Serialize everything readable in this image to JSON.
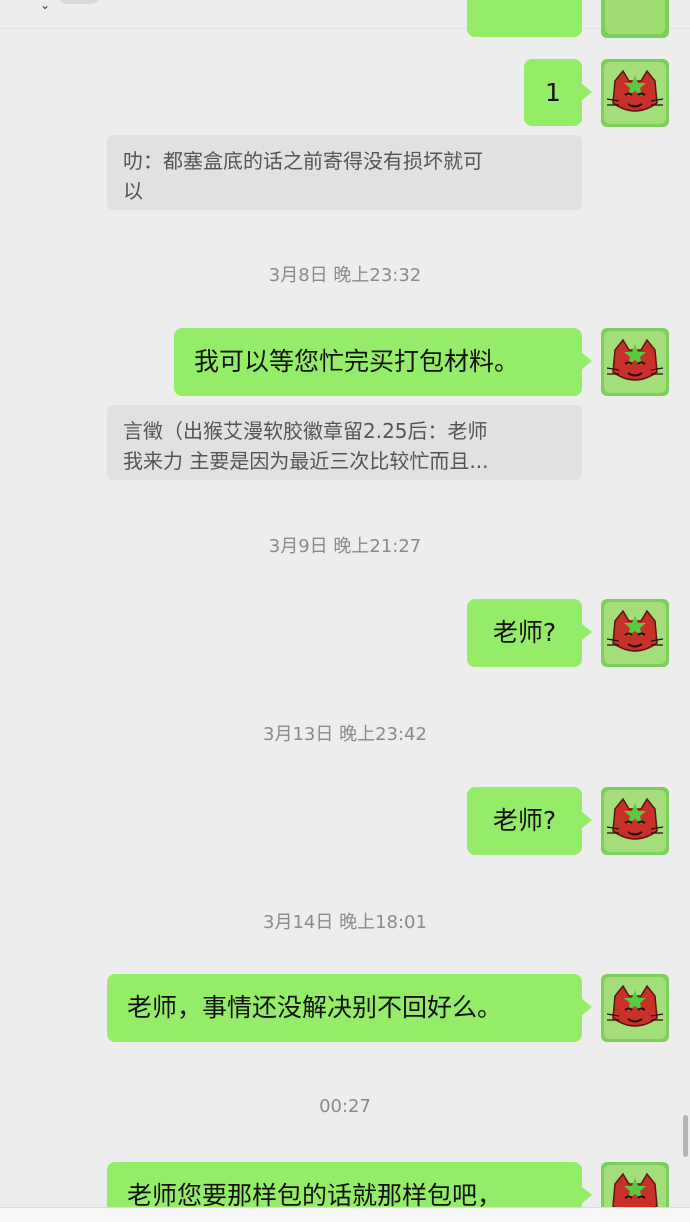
{
  "messages": {
    "m1": "1",
    "m2": "我可以等您忙完买打包材料。",
    "m3": "老师?",
    "m4": "老师?",
    "m5": "老师，事情还没解决别不回好么。",
    "m6": "老师您要那样包的话就那样包吧，"
  },
  "quotes": {
    "q1": {
      "line1": "叻：都塞盒底的话之前寄得没有损坏就可",
      "line2": "以"
    },
    "q2": {
      "line1": "言徵（出猴艾漫软胶徽章留2.25后：老师",
      "line2": "我来力 主要是因为最近三次比较忙而且..."
    }
  },
  "timestamps": {
    "t1": "3月8日 晚上23:32",
    "t2": "3月9日 晚上21:27",
    "t3": "3月13日 晚上23:42",
    "t4": "3月14日 晚上18:01",
    "t5": "00:27"
  },
  "colors": {
    "sent_bubble": "#95ec69",
    "quote_bg": "#e1e1e1",
    "page_bg": "#ededed",
    "timestamp_text": "#8a8a8a"
  },
  "icons": {
    "avatar": "red-cat-avatar-icon"
  }
}
